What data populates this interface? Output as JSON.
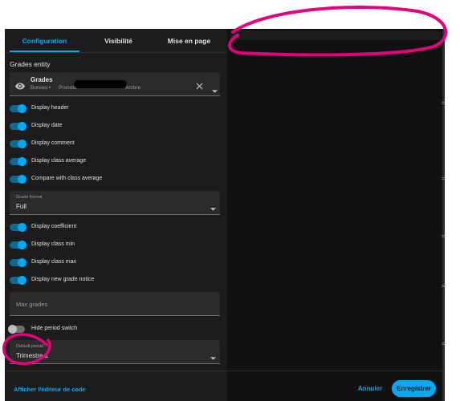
{
  "tabs": [
    {
      "label": "Configuration",
      "active": true
    },
    {
      "label": "Visibilité",
      "active": false
    },
    {
      "label": "Mise en page",
      "active": false
    }
  ],
  "entity_section": {
    "label": "Grades entity",
    "name": "Grades",
    "subtitle_area": "Bureau •",
    "subtitle_device": "Pronote",
    "subtitle_end": "Ambre",
    "icon": "eye-icon"
  },
  "toggles_a": [
    {
      "label": "Display header",
      "on": true
    },
    {
      "label": "Display date",
      "on": true
    },
    {
      "label": "Display comment",
      "on": true
    },
    {
      "label": "Display class average",
      "on": true
    },
    {
      "label": "Compare with class average",
      "on": true
    }
  ],
  "grade_format": {
    "label": "Grade format",
    "value": "Full"
  },
  "toggles_b": [
    {
      "label": "Display coefficient",
      "on": true
    },
    {
      "label": "Display class min",
      "on": true
    },
    {
      "label": "Display class max",
      "on": true
    },
    {
      "label": "Display new grade notice",
      "on": true
    }
  ],
  "max_grades": {
    "placeholder": "Max grades"
  },
  "hide_period": {
    "label": "Hide period switch",
    "on": false
  },
  "default_period": {
    "label": "Default period",
    "value": "Trimestre 1"
  },
  "footer": {
    "code_editor": "Afficher l'éditeur de code",
    "cancel": "Annuler",
    "save": "Enregistrer"
  },
  "colors": {
    "accent": "#03a9f4",
    "background": "#1c1c1c",
    "annotation": "#e4007c"
  }
}
